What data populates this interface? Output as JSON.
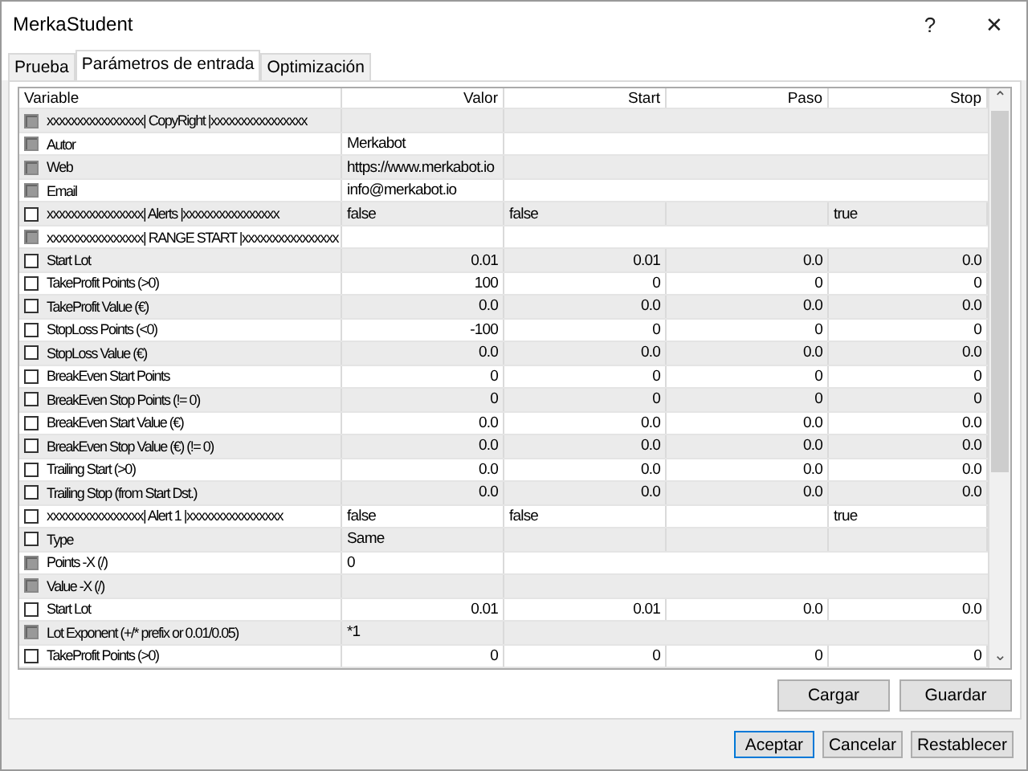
{
  "window": {
    "title": "MerkaStudent",
    "help": "?",
    "close": "✕"
  },
  "tabs": [
    {
      "label": "Prueba",
      "selected": false
    },
    {
      "label": "Parámetros de entrada",
      "selected": true
    },
    {
      "label": "Optimización",
      "selected": false
    }
  ],
  "table": {
    "columns": [
      "Variable",
      "Valor",
      "Start",
      "Paso",
      "Stop"
    ],
    "rows": [
      {
        "disabled": true,
        "kind": "text",
        "cells": [
          "xxxxxxxxxxxxxxxx| CopyRight |xxxxxxxxxxxxxxxx",
          null,
          null,
          null,
          null
        ]
      },
      {
        "disabled": true,
        "kind": "text",
        "cells": [
          "Autor",
          "Merkabot",
          null,
          null,
          null
        ]
      },
      {
        "disabled": true,
        "kind": "text",
        "cells": [
          "Web",
          "https://www.merkabot.io",
          null,
          null,
          null
        ]
      },
      {
        "disabled": true,
        "kind": "text",
        "cells": [
          "Email",
          "info@merkabot.io",
          null,
          null,
          null
        ]
      },
      {
        "disabled": false,
        "kind": "text",
        "cells": [
          "xxxxxxxxxxxxxxxx| Alerts |xxxxxxxxxxxxxxxx",
          "false",
          "false",
          null,
          "true"
        ]
      },
      {
        "disabled": true,
        "kind": "text",
        "cells": [
          "xxxxxxxxxxxxxxxx| RANGE START |xxxxxxxxxxxxxxxx",
          null,
          null,
          null,
          null
        ]
      },
      {
        "disabled": false,
        "kind": "number",
        "cells": [
          "Start Lot",
          "0.01",
          "0.01",
          "0.0",
          "0.0"
        ]
      },
      {
        "disabled": false,
        "kind": "number",
        "cells": [
          "TakeProfit Points (>0)",
          "100",
          "0",
          "0",
          "0"
        ]
      },
      {
        "disabled": false,
        "kind": "number",
        "cells": [
          "TakeProfit Value (€)",
          "0.0",
          "0.0",
          "0.0",
          "0.0"
        ]
      },
      {
        "disabled": false,
        "kind": "number",
        "cells": [
          "StopLoss Points (<0)",
          "-100",
          "0",
          "0",
          "0"
        ]
      },
      {
        "disabled": false,
        "kind": "number",
        "cells": [
          "StopLoss Value (€)",
          "0.0",
          "0.0",
          "0.0",
          "0.0"
        ]
      },
      {
        "disabled": false,
        "kind": "number",
        "cells": [
          "BreakEven Start Points",
          "0",
          "0",
          "0",
          "0"
        ]
      },
      {
        "disabled": false,
        "kind": "number",
        "cells": [
          "BreakEven Stop Points  (!= 0)",
          "0",
          "0",
          "0",
          "0"
        ]
      },
      {
        "disabled": false,
        "kind": "number",
        "cells": [
          "BreakEven Start Value (€)",
          "0.0",
          "0.0",
          "0.0",
          "0.0"
        ]
      },
      {
        "disabled": false,
        "kind": "number",
        "cells": [
          "BreakEven Stop Value (€) (!= 0)",
          "0.0",
          "0.0",
          "0.0",
          "0.0"
        ]
      },
      {
        "disabled": false,
        "kind": "number",
        "cells": [
          "Trailing Start (>0)",
          "0.0",
          "0.0",
          "0.0",
          "0.0"
        ]
      },
      {
        "disabled": false,
        "kind": "number",
        "cells": [
          "Trailing Stop (from Start Dst.)",
          "0.0",
          "0.0",
          "0.0",
          "0.0"
        ]
      },
      {
        "disabled": false,
        "kind": "text",
        "cells": [
          "xxxxxxxxxxxxxxxx| Alert 1 |xxxxxxxxxxxxxxxx",
          "false",
          "false",
          null,
          "true"
        ]
      },
      {
        "disabled": false,
        "kind": "text",
        "cells": [
          "Type",
          "Same",
          null,
          null,
          null
        ]
      },
      {
        "disabled": true,
        "kind": "text",
        "cells": [
          "Points -X (/)",
          "0",
          null,
          null,
          null
        ]
      },
      {
        "disabled": true,
        "kind": "text",
        "cells": [
          "Value -X (/)",
          null,
          null,
          null,
          null
        ]
      },
      {
        "disabled": false,
        "kind": "number",
        "cells": [
          "Start Lot",
          "0.01",
          "0.01",
          "0.0",
          "0.0"
        ]
      },
      {
        "disabled": true,
        "kind": "text",
        "cells": [
          "Lot Exponent (+/* prefix or 0.01/0.05)",
          "*1",
          null,
          null,
          null
        ]
      },
      {
        "disabled": false,
        "kind": "number",
        "cells": [
          "TakeProfit Points (>0)",
          "0",
          "0",
          "0",
          "0"
        ]
      }
    ]
  },
  "scroll_up": "⌃",
  "scroll_down": "⌄",
  "file_buttons": [
    "Cargar",
    "Guardar"
  ],
  "dialog_buttons": [
    {
      "label": "Aceptar",
      "selected": true
    },
    {
      "label": "Cancelar",
      "selected": false
    },
    {
      "label": "Restablecer",
      "selected": false
    }
  ]
}
